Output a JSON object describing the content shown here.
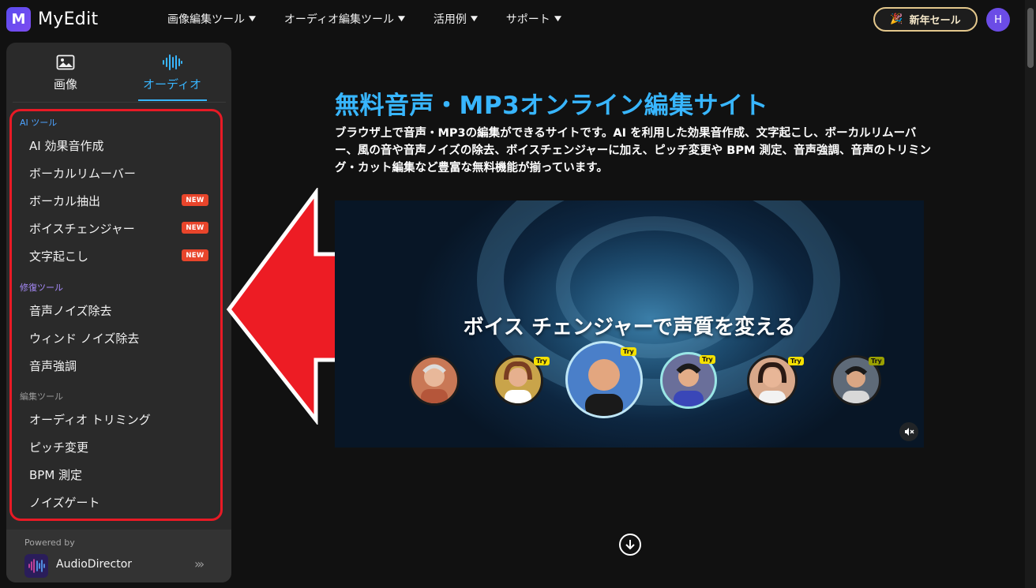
{
  "brand": {
    "name": "MyEdit",
    "logo_letter": "M"
  },
  "nav": {
    "items": [
      {
        "label": "画像編集ツール"
      },
      {
        "label": "オーディオ編集ツール"
      },
      {
        "label": "活用例"
      },
      {
        "label": "サポート"
      }
    ],
    "sale_label": "新年セール",
    "avatar_letter": "H"
  },
  "sidebar": {
    "tabs": [
      {
        "label": "画像",
        "icon": "image-icon",
        "active": false
      },
      {
        "label": "オーディオ",
        "icon": "audio-wave-icon",
        "active": true
      }
    ],
    "groups": [
      {
        "label": "AI ツール",
        "items": [
          {
            "label": "AI 効果音作成",
            "badge": ""
          },
          {
            "label": "ボーカルリムーバー",
            "badge": ""
          },
          {
            "label": "ボーカル抽出",
            "badge": "NEW"
          },
          {
            "label": "ボイスチェンジャー",
            "badge": "NEW"
          },
          {
            "label": "文字起こし",
            "badge": "NEW"
          }
        ]
      },
      {
        "label": "修復ツール",
        "items": [
          {
            "label": "音声ノイズ除去",
            "badge": ""
          },
          {
            "label": "ウィンド ノイズ除去",
            "badge": ""
          },
          {
            "label": "音声強調",
            "badge": ""
          }
        ]
      },
      {
        "label": "編集ツール",
        "items": [
          {
            "label": "オーディオ トリミング",
            "badge": ""
          },
          {
            "label": "ピッチ変更",
            "badge": ""
          },
          {
            "label": "BPM 測定",
            "badge": ""
          },
          {
            "label": "ノイズゲート",
            "badge": ""
          }
        ]
      }
    ],
    "powered_by": {
      "label": "Powered by",
      "product": "AudioDirector"
    }
  },
  "main": {
    "title": "無料音声・MP3オンライン編集サイト",
    "description": "ブラウザ上で音声・MP3の編集ができるサイトです。AI を利用した効果音作成、文字起こし、ボーカルリムーバー、風の音や音声ノイズの除去、ボイスチェンジャーに加え、ピッチ変更や BPM 測定、音声強調、音声のトリミング・カット編集など豊富な無料機能が揃っています。",
    "video": {
      "caption": "ボイス チェンジャーで声質を変える",
      "try_label": "Try",
      "muted": true
    }
  },
  "colors": {
    "accent": "#38b6ff",
    "badge": "#e8452b",
    "highlight_box": "#e81a25",
    "sale_border": "#e3c78c",
    "avatar": "#6b4ce6"
  }
}
